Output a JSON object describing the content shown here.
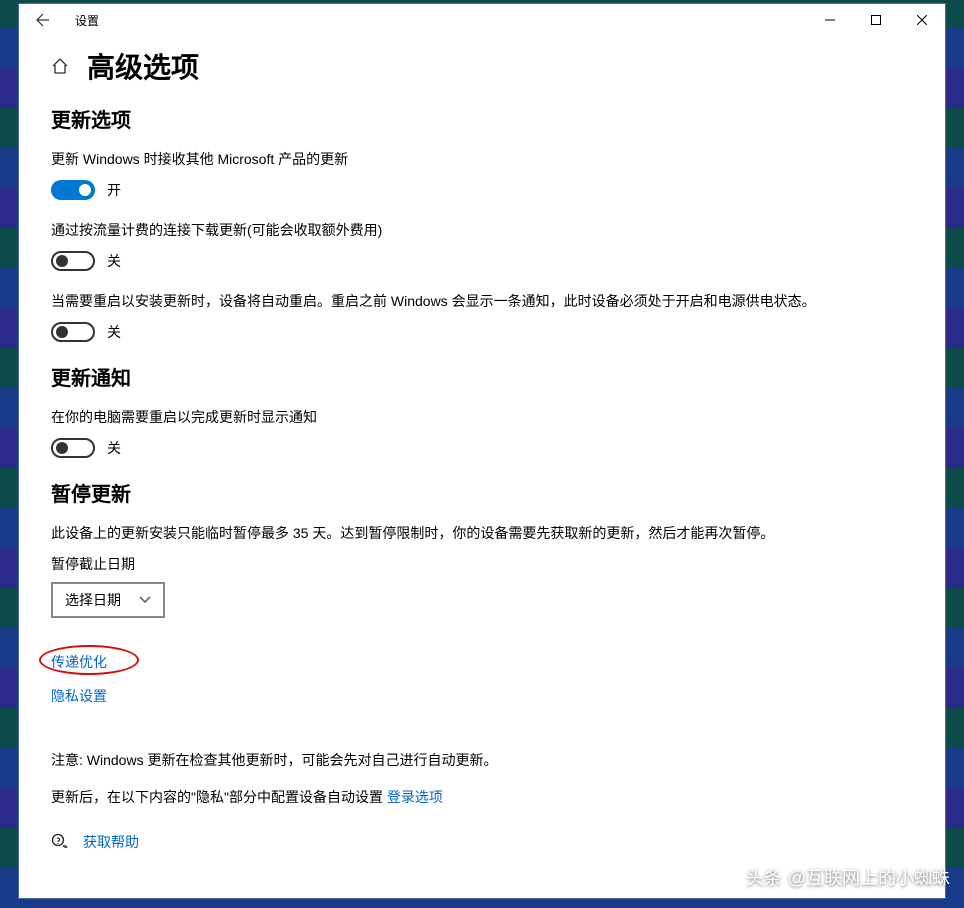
{
  "window": {
    "app_title": "设置"
  },
  "page": {
    "title": "高级选项"
  },
  "sections": {
    "update_options": {
      "title": "更新选项",
      "opt1": {
        "label": "更新 Windows 时接收其他 Microsoft 产品的更新",
        "state_text": "开",
        "on": true
      },
      "opt2": {
        "label": "通过按流量计费的连接下载更新(可能会收取额外费用)",
        "state_text": "关",
        "on": false
      },
      "opt3": {
        "label": "当需要重启以安装更新时，设备将自动重启。重启之前 Windows 会显示一条通知，此时设备必须处于开启和电源供电状态。",
        "state_text": "关",
        "on": false
      }
    },
    "update_notifications": {
      "title": "更新通知",
      "opt1": {
        "label": "在你的电脑需要重启以完成更新时显示通知",
        "state_text": "关",
        "on": false
      }
    },
    "pause_updates": {
      "title": "暂停更新",
      "description": "此设备上的更新安装只能临时暂停最多 35 天。达到暂停限制时，你的设备需要先获取新的更新，然后才能再次暂停。",
      "deadline_label": "暂停截止日期",
      "select_placeholder": "选择日期"
    }
  },
  "links": {
    "delivery_optimization": "传递优化",
    "privacy_settings": "隐私设置",
    "sign_in_options": "登录选项",
    "get_help": "获取帮助"
  },
  "notes": {
    "auto_update": "注意: Windows 更新在检查其他更新时，可能会先对自己进行自动更新。",
    "after_update_prefix": "更新后，在以下内容的\"隐私\"部分中配置设备自动设置 "
  },
  "watermark": {
    "prefix": "头条",
    "text": "@互联网上的小蜘蛛"
  }
}
